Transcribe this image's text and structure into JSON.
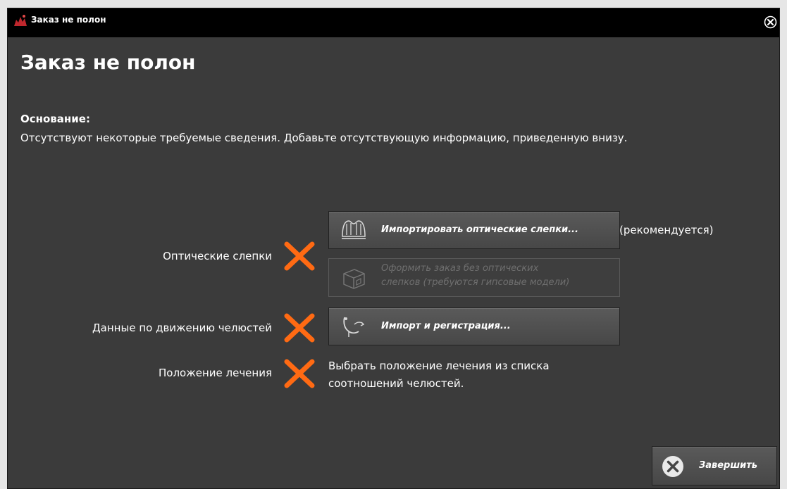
{
  "window": {
    "title": "Заказ не полон",
    "close_icon": "close-circle-icon"
  },
  "dialog": {
    "heading": "Заказ не полон",
    "reason_label": "Основание:",
    "reason_text": "Отсутствуют некоторые требуемые сведения. Добавьте отсутствующую информацию, приведенную внизу."
  },
  "rows": {
    "optical": {
      "label": "Оптические слепки",
      "status": "missing",
      "import_button": "Импортировать оптические слепки...",
      "recommend_note": "(рекомендуется)",
      "no_optical_button": [
        "Оформить заказ без оптических",
        "слепков (требуются гипсовые модели)"
      ],
      "no_optical_enabled": false
    },
    "jaw_motion": {
      "label": "Данные по движению челюстей",
      "status": "missing",
      "button": "Импорт и регистрация..."
    },
    "treatment": {
      "label": "Положение лечения",
      "status": "missing",
      "hint": [
        "Выбрать положение лечения из списка",
        "соотношений челюстей."
      ]
    }
  },
  "footer": {
    "finish_button": "Завершить"
  },
  "colors": {
    "window_bg": "#3b3b3b",
    "titlebar_bg": "#000000",
    "status_missing": "#ff6a13",
    "disabled_text": "#6f6f6f"
  }
}
